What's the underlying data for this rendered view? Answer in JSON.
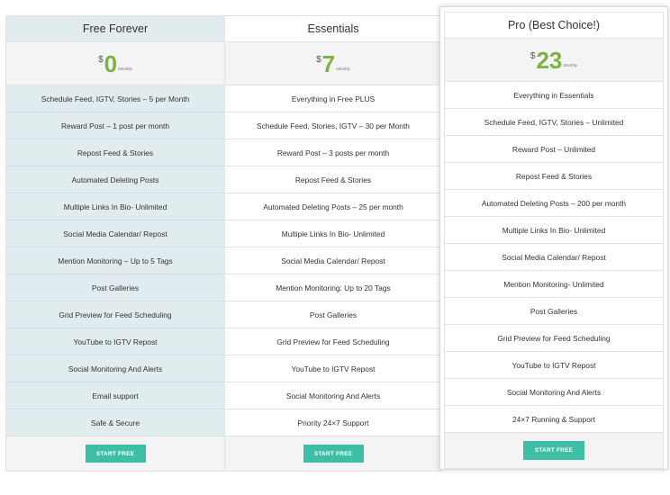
{
  "plans": [
    {
      "name": "Free Forever",
      "currency": "$",
      "amount": "0",
      "period": "Monthly",
      "features": [
        "Schedule Feed, IGTV, Stories – 5 per Month",
        "Reward Post – 1 post per month",
        "Repost Feed & Stories",
        "Automated Deleting Posts",
        "Multiple Links In Bio- Unlimited",
        "Social Media Calendar/ Repost",
        "Mention Monitoring – Up to 5 Tags",
        "Post Galleries",
        "Grid Preview for Feed Scheduling",
        "YouTube to IGTV Repost",
        "Social Monitoring And Alerts",
        "Email support",
        "Safe & Secure"
      ],
      "cta": "START FREE"
    },
    {
      "name": "Essentials",
      "currency": "$",
      "amount": "7",
      "period": "Monthly",
      "features": [
        "Everything in Free PLUS",
        "Schedule Feed, Stories, IGTV – 30 per Month",
        "Reward Post – 3 posts per month",
        "Repost Feed & Stories",
        "Automated Deleting Posts – 25 per month",
        "Multiple Links In Bio- Unlimited",
        "Social Media Calendar/ Repost",
        "Mention Monitoring: Up to 20 Tags",
        "Post Galleries",
        "Grid Preview for Feed Scheduling",
        "YouTube to IGTV Repost",
        "Social Monitoring And Alerts",
        "Priority 24×7 Support"
      ],
      "cta": "START FREE"
    },
    {
      "name": "Pro (Best Choice!)",
      "currency": "$",
      "amount": "23",
      "period": "Monthly",
      "features": [
        "Everything in Essentials",
        "Schedule Feed, IGTV, Stories – Unlimited",
        "Reward Post – Unlimited",
        "Repost Feed & Stories",
        "Automated Deleting Posts – 200 per month",
        "Multiple Links In Bio- Unlimited",
        "Social Media Calendar/ Repost",
        "Mention Monitoring- Unlimited",
        "Post Galleries",
        "Grid Preview for Feed Scheduling",
        "YouTube to IGTV Repost",
        "Social Monitoring And Alerts",
        "24×7 Running & Support"
      ],
      "cta": "START FREE"
    }
  ],
  "colors": {
    "free_bg": "#e1ecef",
    "price_green": "#7cb342",
    "button_teal": "#3dbfa5"
  }
}
